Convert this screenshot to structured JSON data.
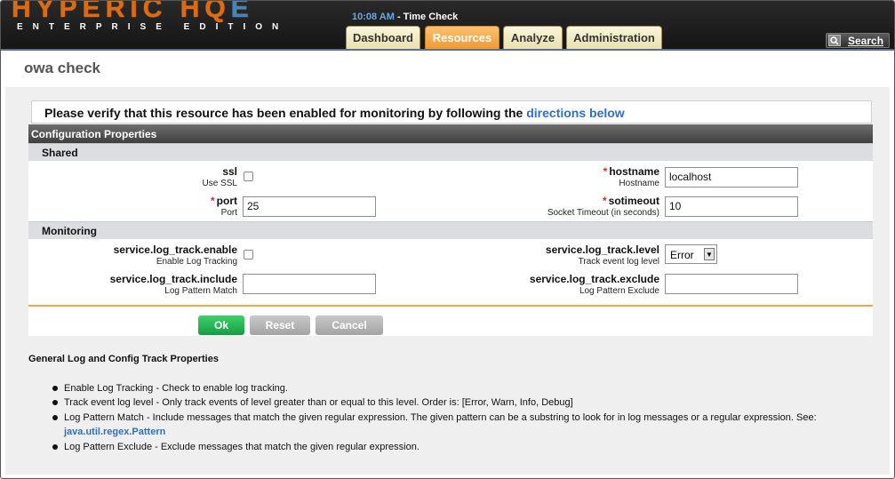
{
  "header": {
    "logo_main": "HYPERIC HQ",
    "logo_accent": "E",
    "logo_sub": "ENTERPRISE EDITION",
    "time": "10:08 AM",
    "time_separator": " - ",
    "time_title": "Time Check",
    "tabs": [
      {
        "label": "Dashboard",
        "active": false
      },
      {
        "label": "Resources",
        "active": true
      },
      {
        "label": "Analyze",
        "active": false
      },
      {
        "label": "Administration",
        "active": false
      }
    ],
    "search_label": "Search"
  },
  "page": {
    "title": "owa check",
    "notice_text": "Please verify that this resource has been enabled for monitoring by following the",
    "notice_link": "directions below"
  },
  "config": {
    "header": "Configuration Properties",
    "shared_section": "Shared",
    "monitoring_section": "Monitoring",
    "fields": {
      "ssl": {
        "label": "ssl",
        "sublabel": "Use SSL",
        "checked": false
      },
      "hostname": {
        "label": "hostname",
        "sublabel": "Hostname",
        "value": "localhost",
        "required": true
      },
      "port": {
        "label": "port",
        "sublabel": "Port",
        "value": "25",
        "required": true
      },
      "sotimeout": {
        "label": "sotimeout",
        "sublabel": "Socket Timeout (in seconds)",
        "value": "10",
        "required": true
      },
      "log_enable": {
        "label": "service.log_track.enable",
        "sublabel": "Enable Log Tracking",
        "checked": false
      },
      "log_level": {
        "label": "service.log_track.level",
        "sublabel": "Track event log level",
        "value": "Error"
      },
      "log_include": {
        "label": "service.log_track.include",
        "sublabel": "Log Pattern Match",
        "value": ""
      },
      "log_exclude": {
        "label": "service.log_track.exclude",
        "sublabel": "Log Pattern Exclude",
        "value": ""
      }
    },
    "required_marker": "*",
    "buttons": {
      "ok": "Ok",
      "reset": "Reset",
      "cancel": "Cancel"
    }
  },
  "help": {
    "title": "General Log and Config Track Properties",
    "items": [
      "Enable Log Tracking - Check to enable log tracking.",
      "Track event log level - Only track events of level greater than or equal to this level. Order is: [Error, Warn, Info, Debug]",
      "Log Pattern Match - Include messages that match the given regular expression. The given pattern can be a substring to look for in log messages or a regular expression. See:",
      "Log Pattern Exclude - Exclude messages that match the given regular expression."
    ],
    "link": "java.util.regex.Pattern"
  }
}
